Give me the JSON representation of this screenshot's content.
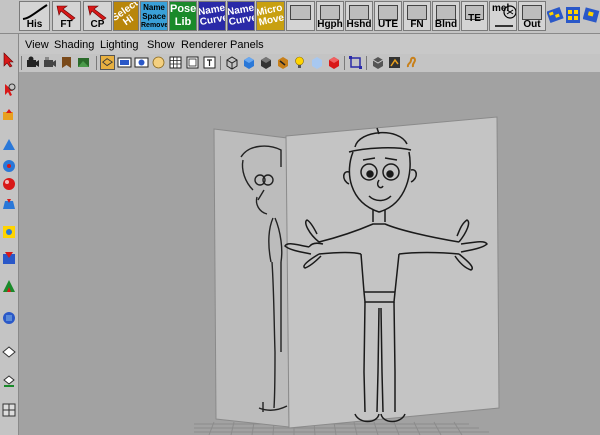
{
  "shelf": {
    "buttons": [
      {
        "label": "His"
      },
      {
        "label": "FT"
      },
      {
        "label": "CP"
      },
      {
        "line1": "Select",
        "line2": "Hi"
      },
      {
        "line1": "Name",
        "line2": "Space",
        "line3": "Remover"
      },
      {
        "line1": "Pose",
        "line2": "Lib"
      },
      {
        "line1": "Name",
        "line2": "Curve"
      },
      {
        "line1": "Name",
        "line2": "Curve"
      },
      {
        "line1": "Micro",
        "line2": "Move"
      },
      {
        "label": ""
      },
      {
        "label": "Hgph"
      },
      {
        "label": "Hshd"
      },
      {
        "label": "UTE"
      },
      {
        "label": "FN"
      },
      {
        "label": "Blnd"
      },
      {
        "label": "TE"
      },
      {
        "label": "mel"
      },
      {
        "label": "Out"
      }
    ]
  },
  "panel": {
    "menu": [
      "View",
      "Shading",
      "Lighting",
      "Show",
      "Renderer",
      "Panels"
    ]
  },
  "colors": {
    "shelf_bg": "#c4c4c4",
    "viewport_bg": "#a2a2a2",
    "select_hi": "#b8860b",
    "name_space": "#3aa0d8",
    "pose_lib": "#1a8a2a",
    "name_curve": "#2a2aa8",
    "micro_move": "#c8a010"
  }
}
